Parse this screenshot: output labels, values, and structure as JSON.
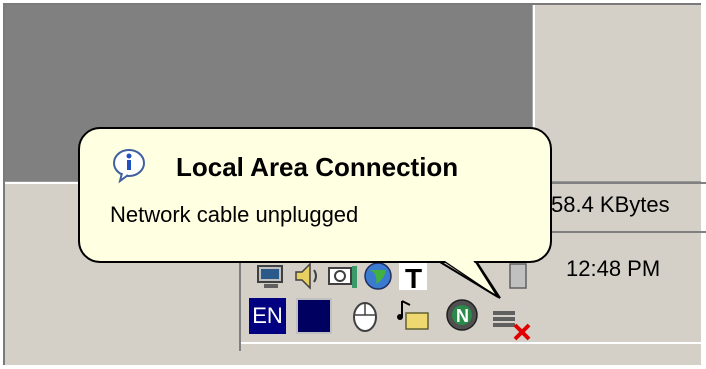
{
  "status_bar": {
    "transfer_size": "58.4 KBytes"
  },
  "taskbar": {
    "clock": "12:48 PM",
    "language_indicator": "EN",
    "tray_icons": [
      "monitor-icon",
      "speaker-icon",
      "connection-icon",
      "globe-icon",
      "font-icon",
      "generic-tray-icon",
      "language-en-icon",
      "blue-square-icon",
      "mouse-icon",
      "music-folder-icon",
      "norton-icon",
      "network-disconnected-icon"
    ]
  },
  "balloon": {
    "title": "Local Area Connection",
    "message": "Network cable unplugged",
    "icon": "info-icon",
    "background": "#ffffe1"
  },
  "colors": {
    "window_face": "#d4d0c8",
    "dark_panel": "#808080",
    "error_x": "#e00000"
  }
}
